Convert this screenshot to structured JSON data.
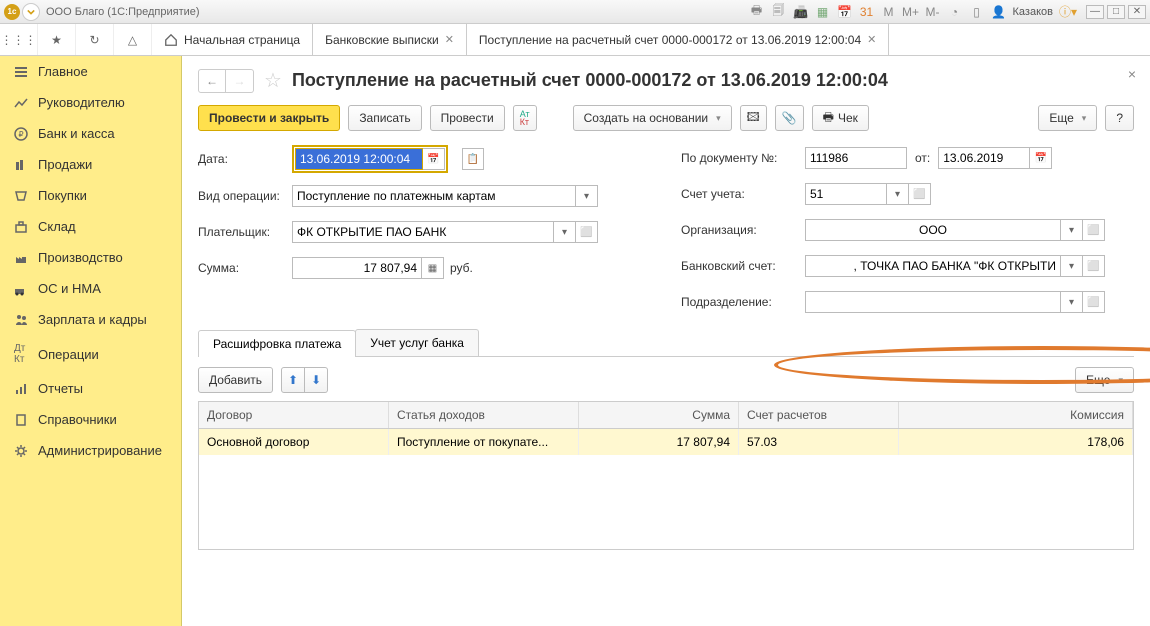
{
  "titlebar": {
    "app_title": "ООО Благо  (1С:Предприятие)",
    "user": "Казаков"
  },
  "topstrip": {
    "home": "Начальная страница",
    "tab1": "Банковские выписки",
    "tab2": "Поступление на расчетный счет 0000-000172 от 13.06.2019 12:00:04"
  },
  "sidebar": {
    "items": [
      "Главное",
      "Руководителю",
      "Банк и касса",
      "Продажи",
      "Покупки",
      "Склад",
      "Производство",
      "ОС и НМА",
      "Зарплата и кадры",
      "Операции",
      "Отчеты",
      "Справочники",
      "Администрирование"
    ]
  },
  "page": {
    "title": "Поступление на расчетный счет 0000-000172 от 13.06.2019 12:00:04"
  },
  "actions": {
    "primary": "Провести и закрыть",
    "save": "Записать",
    "post": "Провести",
    "create_based": "Создать на основании",
    "cheque": "Чек",
    "more": "Еще",
    "q": "?"
  },
  "form": {
    "date_lbl": "Дата:",
    "date_val": "13.06.2019 12:00:04",
    "optype_lbl": "Вид операции:",
    "optype_val": "Поступление по платежным картам",
    "payer_lbl": "Плательщик:",
    "payer_val": "ФК ОТКРЫТИЕ ПАО БАНК",
    "sum_lbl": "Сумма:",
    "sum_val": "17 807,94",
    "sum_unit": "руб.",
    "docnum_lbl": "По документу №:",
    "docnum_val": "111986",
    "from_lbl": "от:",
    "from_val": "13.06.2019",
    "acct_lbl": "Счет учета:",
    "acct_val": "51",
    "org_lbl": "Организация:",
    "org_val": "ООО",
    "bank_lbl": "Банковский счет:",
    "bank_val": ", ТОЧКА ПАО БАНКА \"ФК ОТКРЫТИ",
    "dept_lbl": "Подразделение:",
    "dept_val": ""
  },
  "subtabs": {
    "t1": "Расшифровка платежа",
    "t2": "Учет услуг банка"
  },
  "subbar": {
    "add": "Добавить",
    "more": "Еще"
  },
  "table": {
    "h1": "Договор",
    "h2": "Статья доходов",
    "h3": "Сумма",
    "h4": "Счет расчетов",
    "h5": "Комиссия",
    "r1c1": "Основной договор",
    "r1c2": "Поступление от покупате...",
    "r1c3": "17 807,94",
    "r1c4": "57.03",
    "r1c5": "178,06"
  }
}
